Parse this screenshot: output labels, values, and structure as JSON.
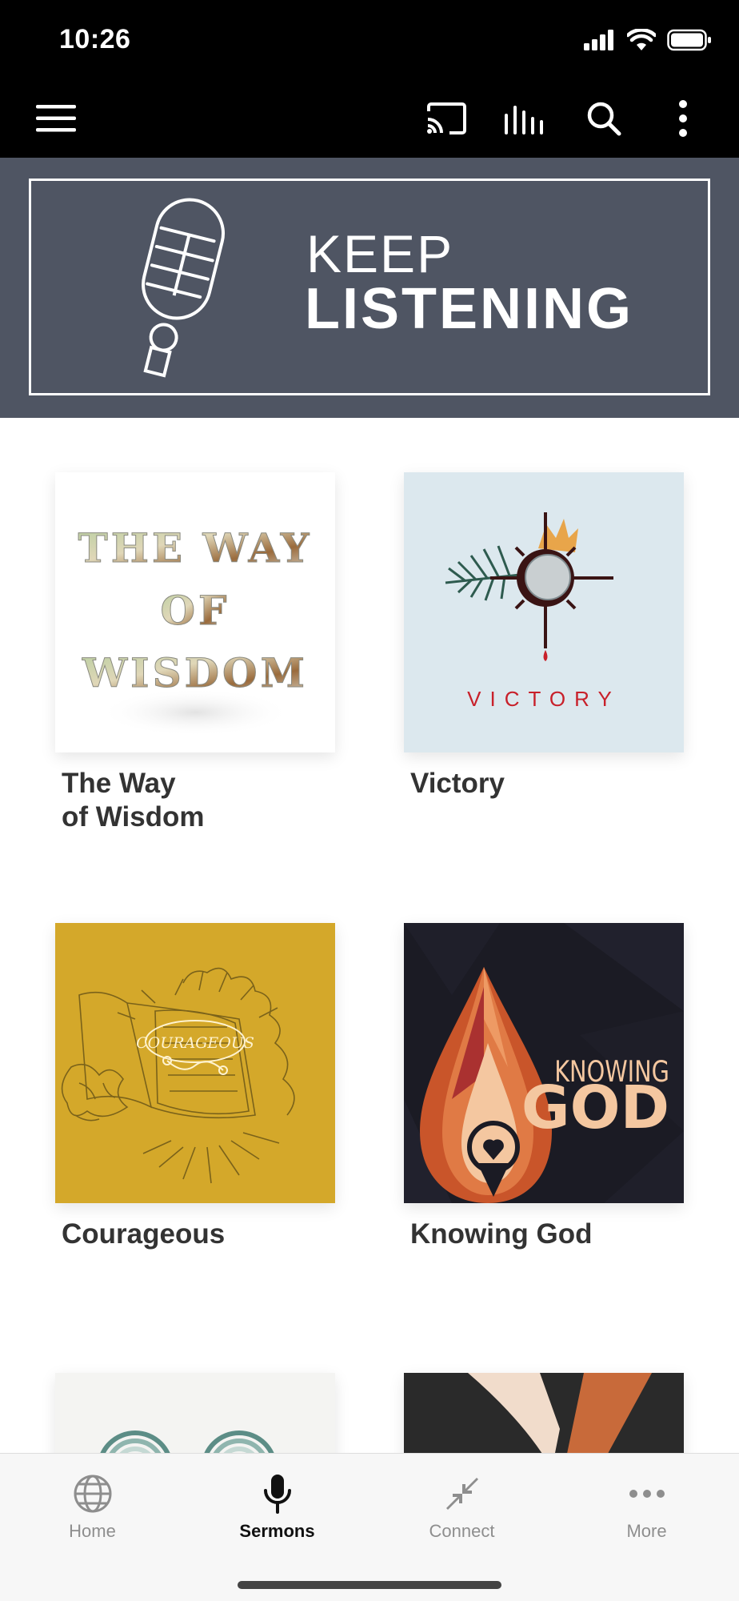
{
  "status": {
    "time": "10:26"
  },
  "banner": {
    "line1": "KEEP",
    "line2": "LISTENING"
  },
  "series": [
    {
      "title": "The Way\nof Wisdom",
      "art_text": [
        "THE WAY",
        "OF",
        "WISDOM"
      ]
    },
    {
      "title": "Victory",
      "art_text": "VICTORY"
    },
    {
      "title": "Courageous",
      "art_text": "COURAGEOUS"
    },
    {
      "title": "Knowing God",
      "art_text": [
        "KNOWING",
        "GOD"
      ]
    },
    {
      "title": ""
    },
    {
      "title": ""
    }
  ],
  "tabs": [
    {
      "label": "Home",
      "icon": "globe-icon",
      "active": false
    },
    {
      "label": "Sermons",
      "icon": "microphone-icon",
      "active": true
    },
    {
      "label": "Connect",
      "icon": "collapse-arrows-icon",
      "active": false
    },
    {
      "label": "More",
      "icon": "more-dots-icon",
      "active": false
    }
  ],
  "colors": {
    "toolbar": "#000000",
    "banner": "#4f5563",
    "victory_bg": "#dce8ee",
    "courageous_bg": "#d4a82a",
    "knowing_god_bg": "#1b1b24",
    "tab_active": "#111111",
    "tab_inactive": "#8e8e8e"
  }
}
